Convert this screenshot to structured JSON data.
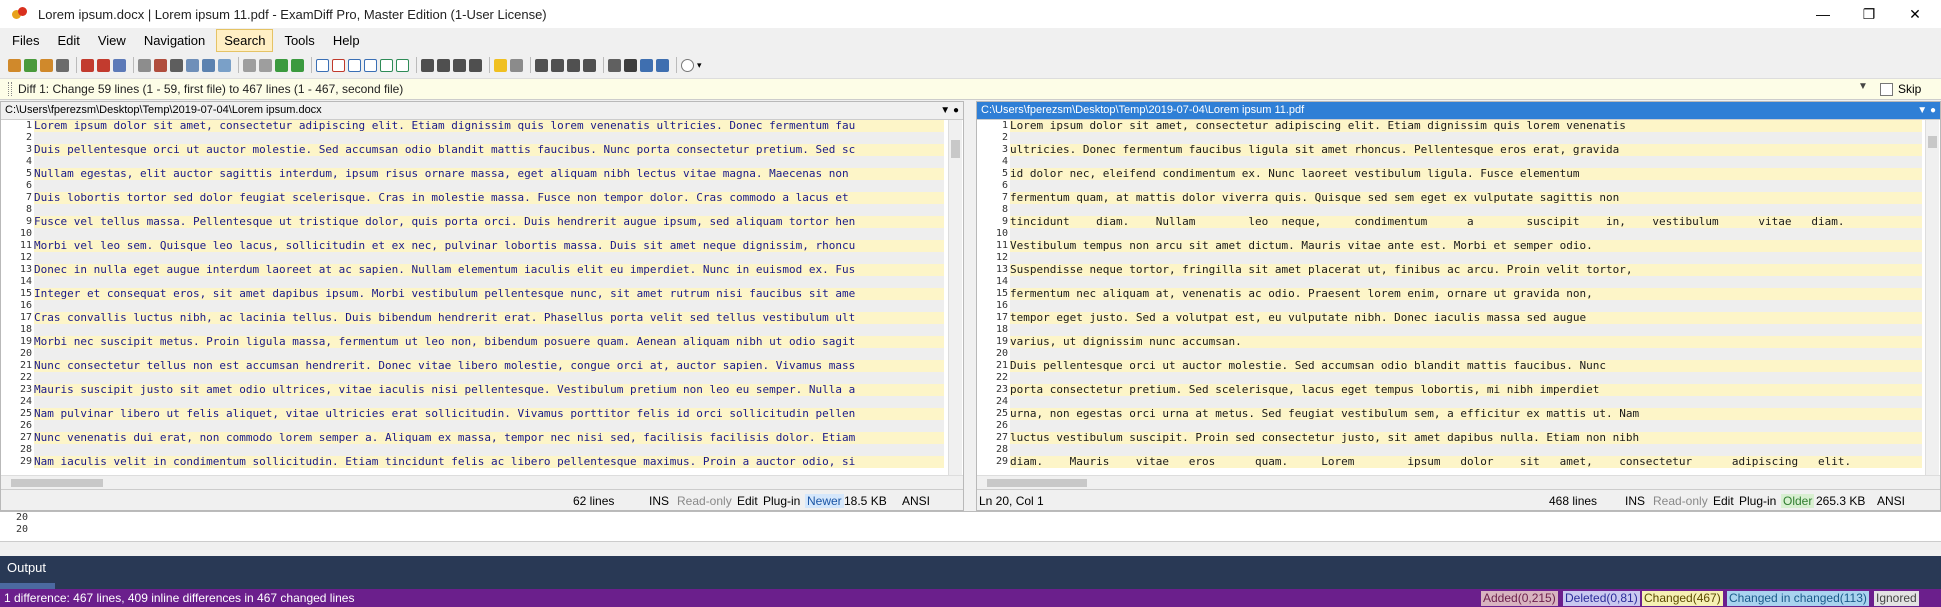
{
  "window": {
    "title": "Lorem ipsum.docx | Lorem ipsum 11.pdf - ExamDiff Pro, Master Edition (1-User License)"
  },
  "menu": [
    "Files",
    "Edit",
    "View",
    "Navigation",
    "Search",
    "Tools",
    "Help"
  ],
  "diff_summary": "Diff 1: Change 59 lines (1 - 59, first file) to 467 lines (1 - 467, second file)",
  "skip_label": "Skip",
  "left": {
    "path": "C:\\Users\\fperezsm\\Desktop\\Temp\\2019-07-04\\Lorem ipsum.docx",
    "lines": [
      {
        "n": "1",
        "t": "Lorem ipsum dolor sit amet, consectetur adipiscing elit. Etiam dignissim quis lorem venenatis ultricies. Donec fermentum fau"
      },
      {
        "n": "2",
        "t": ""
      },
      {
        "n": "3",
        "t": "Duis pellentesque orci ut auctor molestie. Sed accumsan odio blandit mattis faucibus. Nunc porta consectetur pretium. Sed sc"
      },
      {
        "n": "4",
        "t": ""
      },
      {
        "n": "5",
        "t": "Nullam egestas, elit auctor sagittis interdum, ipsum risus ornare massa, eget aliquam nibh lectus vitae magna. Maecenas non"
      },
      {
        "n": "6",
        "t": ""
      },
      {
        "n": "7",
        "t": "Duis lobortis tortor sed dolor feugiat scelerisque. Cras in molestie massa. Fusce non tempor dolor. Cras commodo a lacus et"
      },
      {
        "n": "8",
        "t": ""
      },
      {
        "n": "9",
        "t": "Fusce vel tellus massa. Pellentesque ut tristique dolor, quis porta orci. Duis hendrerit augue ipsum, sed aliquam tortor hen"
      },
      {
        "n": "10",
        "t": ""
      },
      {
        "n": "11",
        "t": "Morbi vel leo sem. Quisque leo lacus, sollicitudin et ex nec, pulvinar lobortis massa. Duis sit amet neque dignissim, rhoncu"
      },
      {
        "n": "12",
        "t": ""
      },
      {
        "n": "13",
        "t": "Donec in nulla eget augue interdum laoreet at ac sapien. Nullam elementum iaculis elit eu imperdiet. Nunc in euismod ex. Fus"
      },
      {
        "n": "14",
        "t": ""
      },
      {
        "n": "15",
        "t": "Integer et consequat eros, sit amet dapibus ipsum. Morbi vestibulum pellentesque nunc, sit amet rutrum nisi faucibus sit ame"
      },
      {
        "n": "16",
        "t": ""
      },
      {
        "n": "17",
        "t": "Cras convallis luctus nibh, ac lacinia tellus. Duis bibendum hendrerit erat. Phasellus porta velit sed tellus vestibulum ult"
      },
      {
        "n": "18",
        "t": ""
      },
      {
        "n": "19",
        "t": "Morbi nec suscipit metus. Proin ligula massa, fermentum ut leo non, bibendum posuere quam. Aenean aliquam nibh ut odio sagit"
      },
      {
        "n": "20",
        "t": ""
      },
      {
        "n": "21",
        "t": "Nunc consectetur tellus non est accumsan hendrerit. Donec vitae libero molestie, congue orci at, auctor sapien. Vivamus mass"
      },
      {
        "n": "22",
        "t": ""
      },
      {
        "n": "23",
        "t": "Mauris suscipit justo sit amet odio ultrices, vitae iaculis nisi pellentesque. Vestibulum pretium non leo eu semper. Nulla a"
      },
      {
        "n": "24",
        "t": ""
      },
      {
        "n": "25",
        "t": "Nam pulvinar libero ut felis aliquet, vitae ultricies erat sollicitudin. Vivamus porttitor felis id orci sollicitudin pellen"
      },
      {
        "n": "26",
        "t": ""
      },
      {
        "n": "27",
        "t": "Nunc venenatis dui erat, non commodo lorem semper a. Aliquam ex massa, tempor nec nisi sed, facilisis facilisis dolor. Etiam"
      },
      {
        "n": "28",
        "t": ""
      },
      {
        "n": "29",
        "t": "Nam iaculis velit in condimentum sollicitudin. Etiam tincidunt felis ac libero pellentesque maximus. Proin a auctor odio, si"
      }
    ],
    "status": {
      "lines": "62 lines",
      "mode": "INS",
      "readonly": "Read-only",
      "edit": "Edit",
      "plugin": "Plug-in",
      "age": "Newer",
      "size": "18.5 KB",
      "enc": "ANSI"
    }
  },
  "right": {
    "path": "C:\\Users\\fperezsm\\Desktop\\Temp\\2019-07-04\\Lorem ipsum 11.pdf",
    "lines": [
      {
        "n": "1",
        "t": "Lorem ipsum dolor sit amet, consectetur adipiscing elit. Etiam dignissim quis lorem venenatis"
      },
      {
        "n": "2",
        "t": ""
      },
      {
        "n": "3",
        "t": "ultricies. Donec fermentum faucibus ligula sit amet rhoncus. Pellentesque eros erat, gravida"
      },
      {
        "n": "4",
        "t": ""
      },
      {
        "n": "5",
        "t": "id dolor nec, eleifend condimentum ex. Nunc laoreet vestibulum ligula. Fusce elementum"
      },
      {
        "n": "6",
        "t": ""
      },
      {
        "n": "7",
        "t": "fermentum quam, at mattis dolor viverra quis. Quisque sed sem eget ex vulputate sagittis non"
      },
      {
        "n": "8",
        "t": ""
      },
      {
        "n": "9",
        "t": "tincidunt    diam.    Nullam        leo  neque,     condimentum      a        suscipit    in,    vestibulum      vitae   diam."
      },
      {
        "n": "10",
        "t": ""
      },
      {
        "n": "11",
        "t": "Vestibulum tempus non arcu sit amet dictum. Mauris vitae ante est. Morbi et semper odio."
      },
      {
        "n": "12",
        "t": ""
      },
      {
        "n": "13",
        "t": "Suspendisse neque tortor, fringilla sit amet placerat ut, finibus ac arcu. Proin velit tortor,"
      },
      {
        "n": "14",
        "t": ""
      },
      {
        "n": "15",
        "t": "fermentum nec aliquam at, venenatis ac odio. Praesent lorem enim, ornare ut gravida non,"
      },
      {
        "n": "16",
        "t": ""
      },
      {
        "n": "17",
        "t": "tempor eget justo. Sed a volutpat est, eu vulputate nibh. Donec iaculis massa sed augue"
      },
      {
        "n": "18",
        "t": ""
      },
      {
        "n": "19",
        "t": "varius, ut dignissim nunc accumsan."
      },
      {
        "n": "20",
        "t": ""
      },
      {
        "n": "21",
        "t": "Duis pellentesque orci ut auctor molestie. Sed accumsan odio blandit mattis faucibus. Nunc"
      },
      {
        "n": "22",
        "t": ""
      },
      {
        "n": "23",
        "t": "porta consectetur pretium. Sed scelerisque, lacus eget tempus lobortis, mi nibh imperdiet"
      },
      {
        "n": "24",
        "t": ""
      },
      {
        "n": "25",
        "t": "urna, non egestas orci urna at metus. Sed feugiat vestibulum sem, a efficitur ex mattis ut. Nam"
      },
      {
        "n": "26",
        "t": ""
      },
      {
        "n": "27",
        "t": "luctus vestibulum suscipit. Proin sed consectetur justo, sit amet dapibus nulla. Etiam non nibh"
      },
      {
        "n": "28",
        "t": ""
      },
      {
        "n": "29",
        "t": "diam.    Mauris    vitae   eros      quam.     Lorem        ipsum   dolor    sit   amet,    consectetur      adipiscing   elit."
      }
    ],
    "status": {
      "position": "Ln 20, Col 1",
      "lines": "468 lines",
      "mode": "INS",
      "readonly": "Read-only",
      "edit": "Edit",
      "plugin": "Plug-in",
      "age": "Older",
      "size": "265.3 KB",
      "enc": "ANSI"
    }
  },
  "bottom_lines": [
    "20",
    "20"
  ],
  "output": {
    "title": "Output"
  },
  "statusbar": {
    "summary": "1 difference: 467 lines, 409 inline differences in 467 changed lines",
    "legend": [
      {
        "label": "Added(0,215)",
        "bg": "#d8b4c0"
      },
      {
        "label": "Deleted(0,81)",
        "bg": "#c9c8f0"
      },
      {
        "label": "Changed(467)",
        "bg": "#f6f1b4"
      },
      {
        "label": "Changed in changed(113)",
        "bg": "#a9d3ef"
      },
      {
        "label": "Ignored",
        "bg": "#e3e3e3"
      }
    ]
  },
  "colors": {
    "changed_bg": "#fdf5c8",
    "blank_bg": "#eeeeee",
    "left_text": "#1a1a8a",
    "right_text": "#1a1a1a",
    "accent": "#2f7fd6",
    "status_purple": "#6b1f8c"
  }
}
